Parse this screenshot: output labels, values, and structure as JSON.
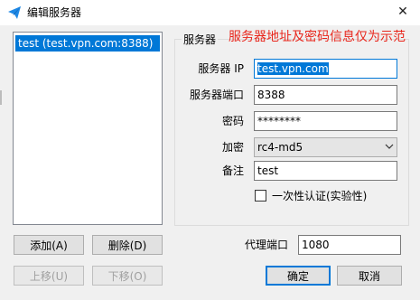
{
  "window": {
    "title": "编辑服务器"
  },
  "server_list": {
    "items": [
      "test (test.vpn.com:8388)"
    ],
    "selected_index": 0
  },
  "buttons": {
    "add": "添加(A)",
    "delete": "删除(D)",
    "move_up": "上移(U)",
    "move_down": "下移(O)",
    "ok": "确定",
    "cancel": "取消"
  },
  "server_group": {
    "label": "服务器",
    "note": "服务器地址及密码信息仅为示范",
    "fields": {
      "server_ip": {
        "label": "服务器 IP",
        "value": "test.vpn.com"
      },
      "server_port": {
        "label": "服务器端口",
        "value": "8388"
      },
      "password": {
        "label": "密码",
        "value": "********"
      },
      "encryption": {
        "label": "加密",
        "value": "rc4-md5"
      },
      "remarks": {
        "label": "备注",
        "value": "test"
      }
    },
    "onetime_auth": {
      "label": "一次性认证(实验性)",
      "checked": false
    }
  },
  "proxy_port": {
    "label": "代理端口",
    "value": "1080"
  },
  "colors": {
    "accent": "#0078d7",
    "note_red": "#e8271d"
  },
  "icons": {
    "app": "paper-plane-icon",
    "close": "close-icon",
    "dropdown": "chevron-down-icon"
  }
}
